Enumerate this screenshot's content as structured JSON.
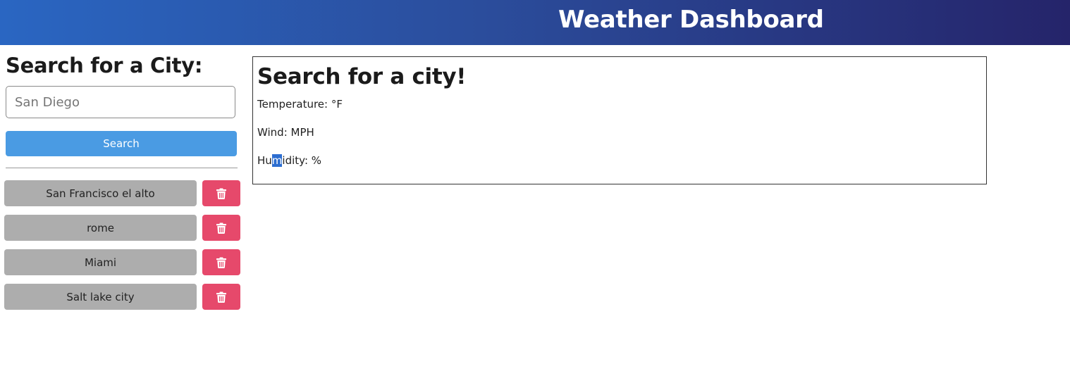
{
  "header": {
    "title": "Weather Dashboard"
  },
  "sidebar": {
    "heading": "Search for a City:",
    "search_input": {
      "placeholder": "San Diego",
      "value": ""
    },
    "search_button_label": "Search",
    "history": [
      {
        "city": "San Francisco el alto",
        "delete_icon": "trash-icon"
      },
      {
        "city": "rome",
        "delete_icon": "trash-icon"
      },
      {
        "city": "Miami",
        "delete_icon": "trash-icon"
      },
      {
        "city": "Salt lake city",
        "delete_icon": "trash-icon"
      }
    ]
  },
  "main": {
    "heading": "Search for a city!",
    "temperature_label": "Temperature: °F",
    "wind_label": "Wind: MPH",
    "humidity_label_prefix": "Hu",
    "humidity_label_selected": "m",
    "humidity_label_suffix": "idity: %"
  },
  "colors": {
    "header_gradient_start": "#2a66c2",
    "header_gradient_end": "#25246a",
    "search_button": "#4a9be3",
    "history_button": "#adadad",
    "delete_button": "#e6496b",
    "text_selection": "#2d6ed0"
  }
}
